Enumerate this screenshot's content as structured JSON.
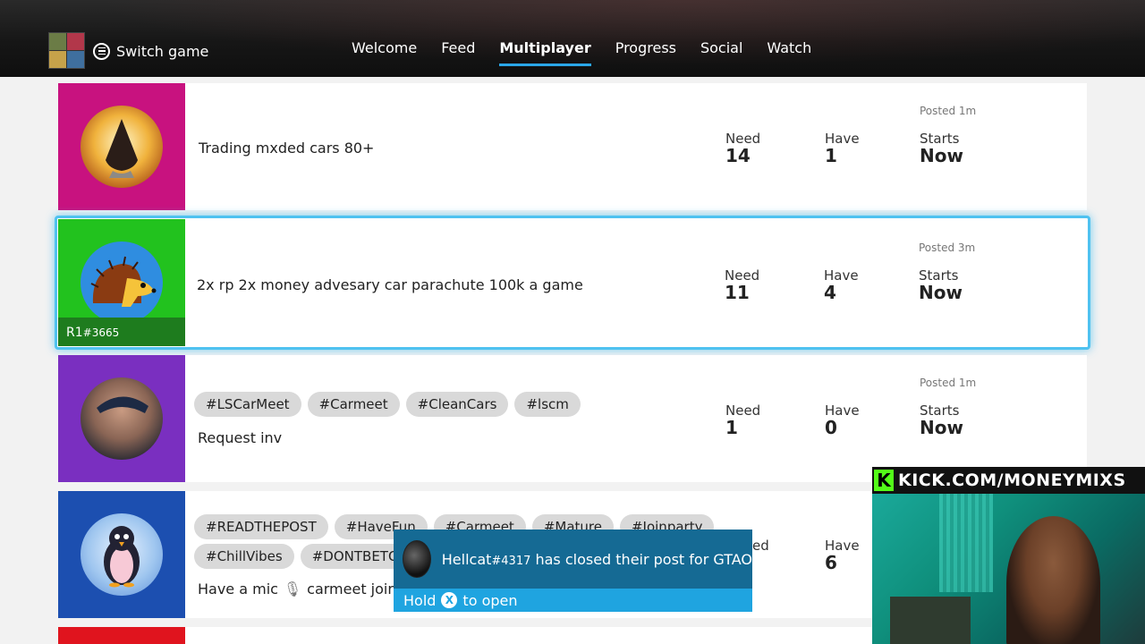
{
  "header": {
    "switch_game_label": "Switch game",
    "nav": [
      {
        "label": "Welcome",
        "active": false
      },
      {
        "label": "Feed",
        "active": false
      },
      {
        "label": "Multiplayer",
        "active": true
      },
      {
        "label": "Progress",
        "active": false
      },
      {
        "label": "Social",
        "active": false
      },
      {
        "label": "Watch",
        "active": false
      }
    ]
  },
  "posts": [
    {
      "text": "Trading mxded cars 80+",
      "need_label": "Need",
      "need": "14",
      "have_label": "Have",
      "have": "1",
      "starts_label": "Starts",
      "starts": "Now",
      "posted": "Posted 1m",
      "avatar_bg": "#c8127f",
      "avatar_icon": "hooded-figure-icon"
    },
    {
      "text": "2x rp 2x money advesary car parachute 100k a game",
      "need_label": "Need",
      "need": "11",
      "have_label": "Have",
      "have": "4",
      "starts_label": "Starts",
      "starts": "Now",
      "posted": "Posted 3m",
      "avatar_bg": "#22c21e",
      "avatar_icon": "hedgehog-icon",
      "gamertag": "R1",
      "gamertag_num": "#3665"
    },
    {
      "tags": [
        "#LSCarMeet",
        "#Carmeet",
        "#CleanCars",
        "#lscm"
      ],
      "text": "Request inv",
      "need_label": "Need",
      "need": "1",
      "have_label": "Have",
      "have": "0",
      "starts_label": "Starts",
      "starts": "Now",
      "posted": "Posted 1m",
      "avatar_bg": "#7a2fc0",
      "avatar_icon": "person-photo-icon"
    },
    {
      "tags_row1": [
        "#READTHEPOST",
        "#HaveFun",
        "#Carmeet",
        "#Mature",
        "#Joinparty"
      ],
      "tags_row2": [
        "#ChillVibes",
        "#DONTBETO"
      ],
      "text_part1": "Have a mic",
      "text_part2": "carmeet join",
      "need_label_partial": "ed",
      "have_label": "Have",
      "have": "6",
      "avatar_bg": "#1c4fb0",
      "avatar_icon": "penguin-icon"
    }
  ],
  "toast": {
    "user": "Hellcat",
    "user_num": "#4317",
    "message": " has closed their post for GTAO",
    "hold": "Hold",
    "to_open": "to open",
    "button_glyph": "X"
  },
  "overlay": {
    "kick_k": "K",
    "kick_text": "KICK.COM/MONEYMIXS"
  },
  "colors": {
    "accent": "#2aa6e8",
    "selected_border": "#4fc2f0",
    "toast_top": "#156a94",
    "toast_bottom": "#1fa4e0",
    "kick_green": "#53fc18"
  }
}
